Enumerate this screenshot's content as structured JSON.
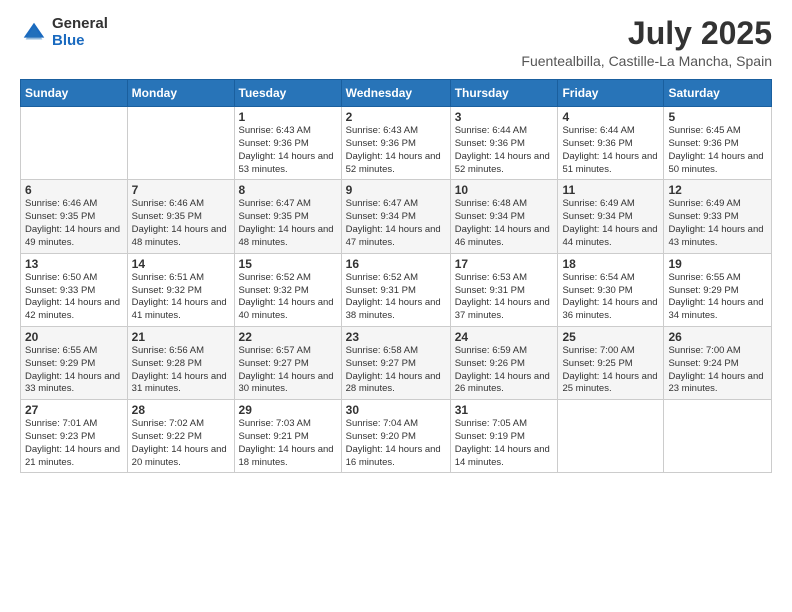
{
  "header": {
    "logo_general": "General",
    "logo_blue": "Blue",
    "month": "July 2025",
    "location": "Fuentealbilla, Castille-La Mancha, Spain"
  },
  "weekdays": [
    "Sunday",
    "Monday",
    "Tuesday",
    "Wednesday",
    "Thursday",
    "Friday",
    "Saturday"
  ],
  "weeks": [
    [
      {
        "day": "",
        "info": ""
      },
      {
        "day": "",
        "info": ""
      },
      {
        "day": "1",
        "info": "Sunrise: 6:43 AM\nSunset: 9:36 PM\nDaylight: 14 hours and 53 minutes."
      },
      {
        "day": "2",
        "info": "Sunrise: 6:43 AM\nSunset: 9:36 PM\nDaylight: 14 hours and 52 minutes."
      },
      {
        "day": "3",
        "info": "Sunrise: 6:44 AM\nSunset: 9:36 PM\nDaylight: 14 hours and 52 minutes."
      },
      {
        "day": "4",
        "info": "Sunrise: 6:44 AM\nSunset: 9:36 PM\nDaylight: 14 hours and 51 minutes."
      },
      {
        "day": "5",
        "info": "Sunrise: 6:45 AM\nSunset: 9:36 PM\nDaylight: 14 hours and 50 minutes."
      }
    ],
    [
      {
        "day": "6",
        "info": "Sunrise: 6:46 AM\nSunset: 9:35 PM\nDaylight: 14 hours and 49 minutes."
      },
      {
        "day": "7",
        "info": "Sunrise: 6:46 AM\nSunset: 9:35 PM\nDaylight: 14 hours and 48 minutes."
      },
      {
        "day": "8",
        "info": "Sunrise: 6:47 AM\nSunset: 9:35 PM\nDaylight: 14 hours and 48 minutes."
      },
      {
        "day": "9",
        "info": "Sunrise: 6:47 AM\nSunset: 9:34 PM\nDaylight: 14 hours and 47 minutes."
      },
      {
        "day": "10",
        "info": "Sunrise: 6:48 AM\nSunset: 9:34 PM\nDaylight: 14 hours and 46 minutes."
      },
      {
        "day": "11",
        "info": "Sunrise: 6:49 AM\nSunset: 9:34 PM\nDaylight: 14 hours and 44 minutes."
      },
      {
        "day": "12",
        "info": "Sunrise: 6:49 AM\nSunset: 9:33 PM\nDaylight: 14 hours and 43 minutes."
      }
    ],
    [
      {
        "day": "13",
        "info": "Sunrise: 6:50 AM\nSunset: 9:33 PM\nDaylight: 14 hours and 42 minutes."
      },
      {
        "day": "14",
        "info": "Sunrise: 6:51 AM\nSunset: 9:32 PM\nDaylight: 14 hours and 41 minutes."
      },
      {
        "day": "15",
        "info": "Sunrise: 6:52 AM\nSunset: 9:32 PM\nDaylight: 14 hours and 40 minutes."
      },
      {
        "day": "16",
        "info": "Sunrise: 6:52 AM\nSunset: 9:31 PM\nDaylight: 14 hours and 38 minutes."
      },
      {
        "day": "17",
        "info": "Sunrise: 6:53 AM\nSunset: 9:31 PM\nDaylight: 14 hours and 37 minutes."
      },
      {
        "day": "18",
        "info": "Sunrise: 6:54 AM\nSunset: 9:30 PM\nDaylight: 14 hours and 36 minutes."
      },
      {
        "day": "19",
        "info": "Sunrise: 6:55 AM\nSunset: 9:29 PM\nDaylight: 14 hours and 34 minutes."
      }
    ],
    [
      {
        "day": "20",
        "info": "Sunrise: 6:55 AM\nSunset: 9:29 PM\nDaylight: 14 hours and 33 minutes."
      },
      {
        "day": "21",
        "info": "Sunrise: 6:56 AM\nSunset: 9:28 PM\nDaylight: 14 hours and 31 minutes."
      },
      {
        "day": "22",
        "info": "Sunrise: 6:57 AM\nSunset: 9:27 PM\nDaylight: 14 hours and 30 minutes."
      },
      {
        "day": "23",
        "info": "Sunrise: 6:58 AM\nSunset: 9:27 PM\nDaylight: 14 hours and 28 minutes."
      },
      {
        "day": "24",
        "info": "Sunrise: 6:59 AM\nSunset: 9:26 PM\nDaylight: 14 hours and 26 minutes."
      },
      {
        "day": "25",
        "info": "Sunrise: 7:00 AM\nSunset: 9:25 PM\nDaylight: 14 hours and 25 minutes."
      },
      {
        "day": "26",
        "info": "Sunrise: 7:00 AM\nSunset: 9:24 PM\nDaylight: 14 hours and 23 minutes."
      }
    ],
    [
      {
        "day": "27",
        "info": "Sunrise: 7:01 AM\nSunset: 9:23 PM\nDaylight: 14 hours and 21 minutes."
      },
      {
        "day": "28",
        "info": "Sunrise: 7:02 AM\nSunset: 9:22 PM\nDaylight: 14 hours and 20 minutes."
      },
      {
        "day": "29",
        "info": "Sunrise: 7:03 AM\nSunset: 9:21 PM\nDaylight: 14 hours and 18 minutes."
      },
      {
        "day": "30",
        "info": "Sunrise: 7:04 AM\nSunset: 9:20 PM\nDaylight: 14 hours and 16 minutes."
      },
      {
        "day": "31",
        "info": "Sunrise: 7:05 AM\nSunset: 9:19 PM\nDaylight: 14 hours and 14 minutes."
      },
      {
        "day": "",
        "info": ""
      },
      {
        "day": "",
        "info": ""
      }
    ]
  ]
}
